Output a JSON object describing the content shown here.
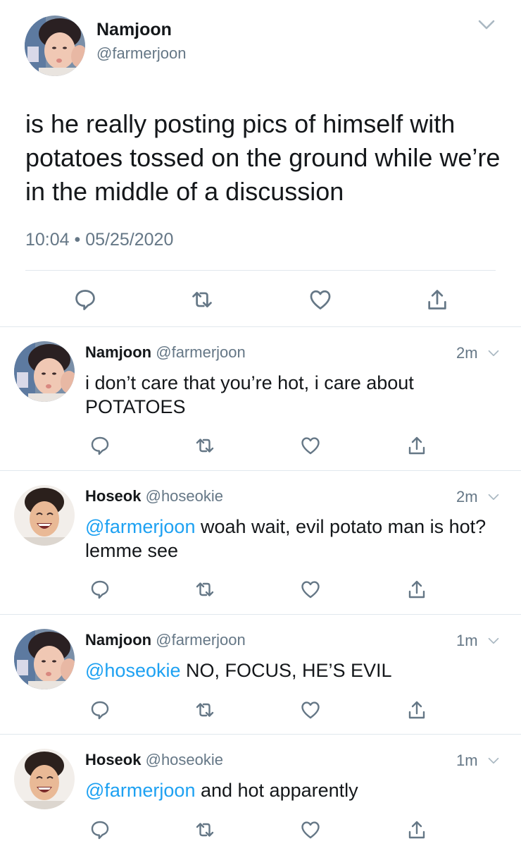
{
  "main_tweet": {
    "name": "Namjoon",
    "handle": "@farmerjoon",
    "text": "is he really posting pics of himself with potatoes tossed on the ground while we’re in the middle of a discussion",
    "time": "10:04",
    "separator": "•",
    "date": "05/25/2020",
    "avatar": "namjoon-avatar",
    "actions": [
      "reply-icon",
      "retweet-icon",
      "like-icon",
      "share-icon"
    ]
  },
  "replies": [
    {
      "name": "Namjoon",
      "handle": "@farmerjoon",
      "time": "2m",
      "mention": "",
      "text": "i don’t care that you’re hot, i care about POTATOES",
      "avatar": "namjoon-avatar"
    },
    {
      "name": "Hoseok",
      "handle": "@hoseokie",
      "time": "2m",
      "mention": "@farmerjoon",
      "text": " woah wait, evil potato man is hot? lemme see",
      "avatar": "hoseok-avatar"
    },
    {
      "name": "Namjoon",
      "handle": "@farmerjoon",
      "time": "1m",
      "mention": "@hoseokie",
      "text": " NO, FOCUS, HE’S EVIL",
      "avatar": "namjoon-avatar"
    },
    {
      "name": "Hoseok",
      "handle": "@hoseokie",
      "time": "1m",
      "mention": "@farmerjoon",
      "text": " and hot apparently",
      "avatar": "hoseok-avatar"
    }
  ],
  "colors": {
    "text": "#14171a",
    "secondary": "#657786",
    "mention": "#1da1f2",
    "divider": "#e1e8ed"
  }
}
